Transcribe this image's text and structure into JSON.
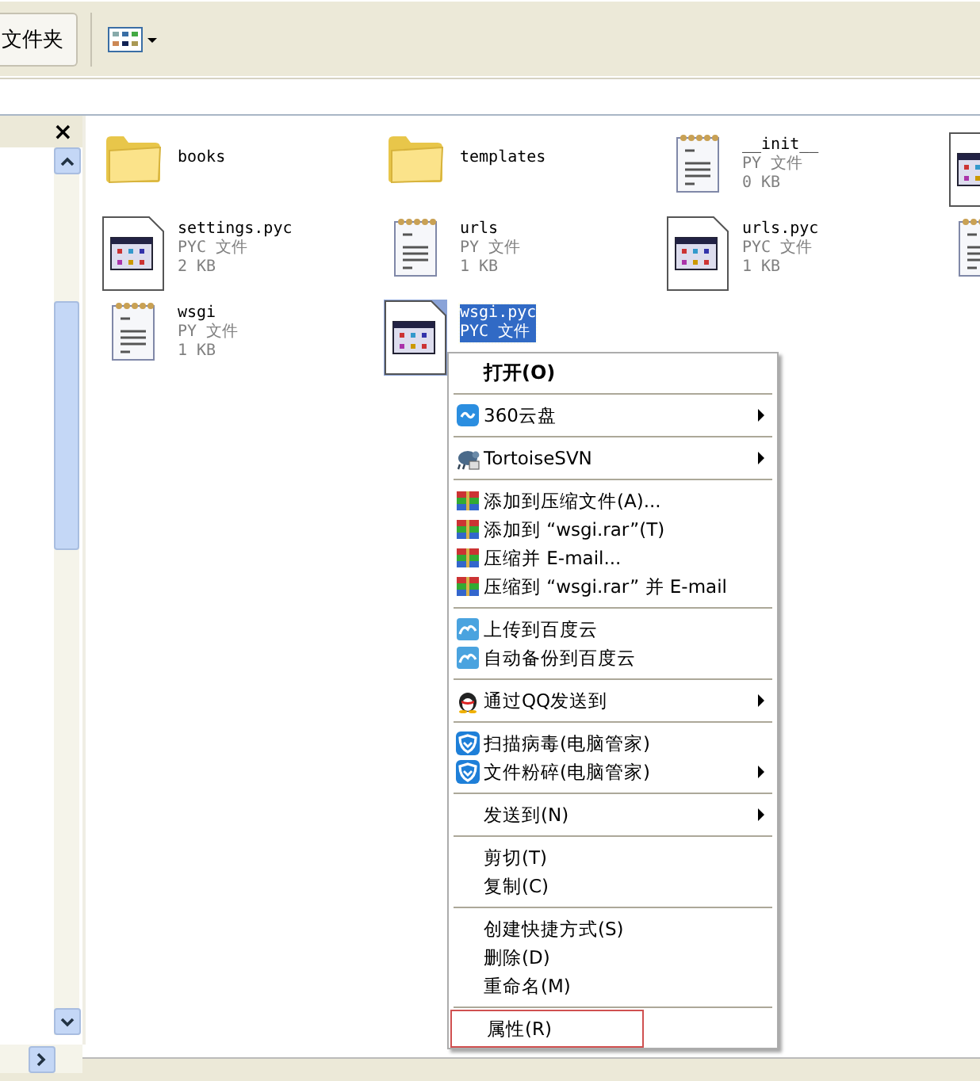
{
  "toolbar": {
    "folder_button": "文件夹"
  },
  "left_pane": {
    "close": "×"
  },
  "files": [
    {
      "kind": "folder",
      "name": "books",
      "selected": false
    },
    {
      "kind": "folder",
      "name": "templates",
      "selected": false
    },
    {
      "kind": "py",
      "name": "__init__",
      "type": "PY 文件",
      "size": "0 KB",
      "selected": false
    },
    {
      "kind": "pyc",
      "selected": false
    },
    {
      "kind": "pyc",
      "name": "settings.pyc",
      "type": "PYC 文件",
      "size": "2 KB",
      "selected": false
    },
    {
      "kind": "py",
      "name": "urls",
      "type": "PY 文件",
      "size": "1 KB",
      "selected": false
    },
    {
      "kind": "pyc",
      "name": "urls.pyc",
      "type": "PYC 文件",
      "size": "1 KB",
      "selected": false
    },
    {
      "kind": "py",
      "selected": false
    },
    {
      "kind": "py",
      "name": "wsgi",
      "type": "PY 文件",
      "size": "1 KB",
      "selected": false
    },
    {
      "kind": "pyc",
      "name": "wsgi.pyc",
      "type": "PYC 文件",
      "selected": true
    }
  ],
  "context_menu": [
    {
      "kind": "plain",
      "label": "打开(O)",
      "default": true,
      "submenu": false,
      "highlighted": false
    },
    {
      "kind": "separator"
    },
    {
      "kind": "cloud",
      "label": "360云盘",
      "default": false,
      "submenu": true,
      "highlighted": false
    },
    {
      "kind": "separator"
    },
    {
      "kind": "turtle",
      "label": "TortoiseSVN",
      "default": false,
      "submenu": true,
      "highlighted": false
    },
    {
      "kind": "separator"
    },
    {
      "kind": "archive",
      "label": "添加到压缩文件(A)...",
      "default": false,
      "submenu": false,
      "highlighted": false
    },
    {
      "kind": "archive",
      "label": "添加到 “wsgi.rar”(T)",
      "default": false,
      "submenu": false,
      "highlighted": false
    },
    {
      "kind": "archive",
      "label": "压缩并 E-mail...",
      "default": false,
      "submenu": false,
      "highlighted": false
    },
    {
      "kind": "archive",
      "label": "压缩到 “wsgi.rar” 并 E-mail",
      "default": false,
      "submenu": false,
      "highlighted": false
    },
    {
      "kind": "separator"
    },
    {
      "kind": "upload",
      "label": "上传到百度云",
      "default": false,
      "submenu": false,
      "highlighted": false
    },
    {
      "kind": "upload",
      "label": "自动备份到百度云",
      "default": false,
      "submenu": false,
      "highlighted": false
    },
    {
      "kind": "separator"
    },
    {
      "kind": "penguin",
      "label": "通过QQ发送到",
      "default": false,
      "submenu": true,
      "highlighted": false
    },
    {
      "kind": "separator"
    },
    {
      "kind": "shield",
      "label": "扫描病毒(电脑管家)",
      "default": false,
      "submenu": false,
      "highlighted": false
    },
    {
      "kind": "shield",
      "label": "文件粉碎(电脑管家)",
      "default": false,
      "submenu": true,
      "highlighted": false
    },
    {
      "kind": "separator"
    },
    {
      "kind": "plain",
      "label": "发送到(N)",
      "default": false,
      "submenu": true,
      "highlighted": false
    },
    {
      "kind": "separator"
    },
    {
      "kind": "plain",
      "label": "剪切(T)",
      "default": false,
      "submenu": false,
      "highlighted": false
    },
    {
      "kind": "plain",
      "label": "复制(C)",
      "default": false,
      "submenu": false,
      "highlighted": false
    },
    {
      "kind": "separator"
    },
    {
      "kind": "plain",
      "label": "创建快捷方式(S)",
      "default": false,
      "submenu": false,
      "highlighted": false
    },
    {
      "kind": "plain",
      "label": "删除(D)",
      "default": false,
      "submenu": false,
      "highlighted": false
    },
    {
      "kind": "plain",
      "label": "重命名(M)",
      "default": false,
      "submenu": false,
      "highlighted": false
    },
    {
      "kind": "separator"
    },
    {
      "kind": "plain",
      "label": "属性(R)",
      "default": false,
      "submenu": false,
      "highlighted": true
    }
  ]
}
